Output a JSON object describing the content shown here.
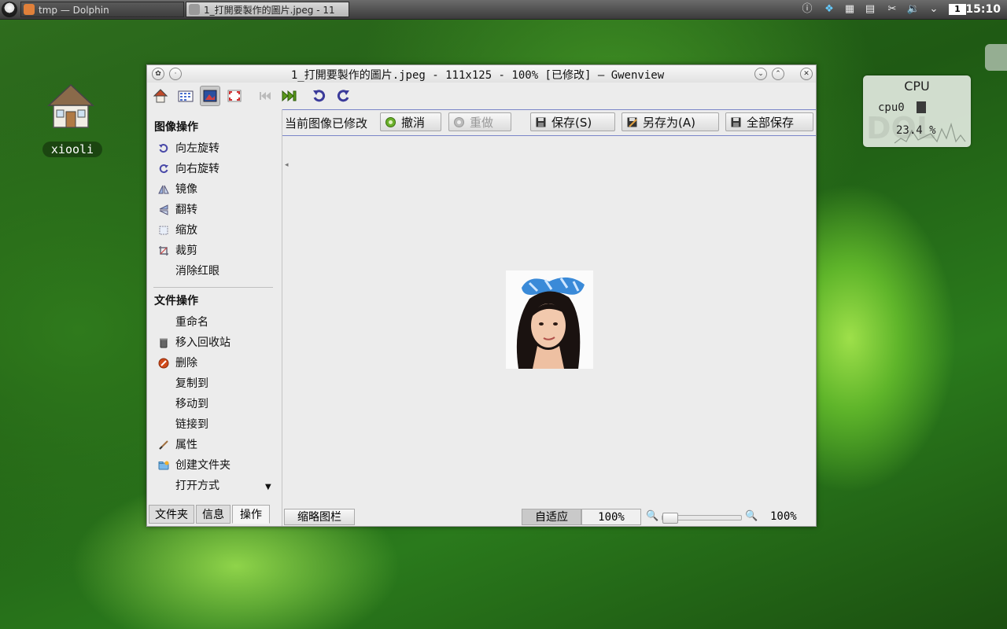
{
  "taskbar": {
    "tasks": [
      {
        "label": "tmp — Dolphin"
      },
      {
        "label": "1_打開要製作的圖片.jpeg - 11"
      }
    ],
    "clock": "15:10",
    "desktop_number": "1"
  },
  "desktop": {
    "home_label": "xiooli"
  },
  "cpu_widget": {
    "title": "CPU",
    "core_label": "cpu0",
    "value": "23.4 %"
  },
  "window": {
    "title": "1_打開要製作的圖片.jpeg - 111x125 - 100% [已修改] — Gwenview"
  },
  "sidebar": {
    "image_ops_title": "图像操作",
    "image_ops": [
      {
        "label": "向左旋转",
        "icon": "rotate-left-icon"
      },
      {
        "label": "向右旋转",
        "icon": "rotate-right-icon"
      },
      {
        "label": "镜像",
        "icon": "mirror-icon"
      },
      {
        "label": "翻转",
        "icon": "flip-icon"
      },
      {
        "label": "缩放",
        "icon": "resize-icon"
      },
      {
        "label": "裁剪",
        "icon": "crop-icon"
      },
      {
        "label": "消除红眼",
        "icon": ""
      }
    ],
    "file_ops_title": "文件操作",
    "file_ops": [
      {
        "label": "重命名",
        "icon": ""
      },
      {
        "label": "移入回收站",
        "icon": "trash-icon"
      },
      {
        "label": "删除",
        "icon": "delete-icon"
      },
      {
        "label": "复制到",
        "icon": ""
      },
      {
        "label": "移动到",
        "icon": ""
      },
      {
        "label": "链接到",
        "icon": ""
      },
      {
        "label": "属性",
        "icon": "properties-icon"
      },
      {
        "label": "创建文件夹",
        "icon": "folder-new-icon"
      },
      {
        "label": "打开方式",
        "icon": ""
      }
    ],
    "tabs": [
      "文件夹",
      "信息",
      "操作"
    ]
  },
  "notification": {
    "text": "当前图像已修改",
    "undo": "撤消",
    "redo": "重做",
    "save": "保存(S)",
    "save_as": "另存为(A)",
    "save_all": "全部保存"
  },
  "statusbar": {
    "thumbnail_bar": "缩略图栏",
    "fit": "自适应",
    "zoom_field": "100%",
    "zoom_readout": "100%",
    "zoom_level": 0.0
  },
  "colors": {
    "notification_border": "#7a86c8",
    "selection": "#c8c8c8"
  }
}
